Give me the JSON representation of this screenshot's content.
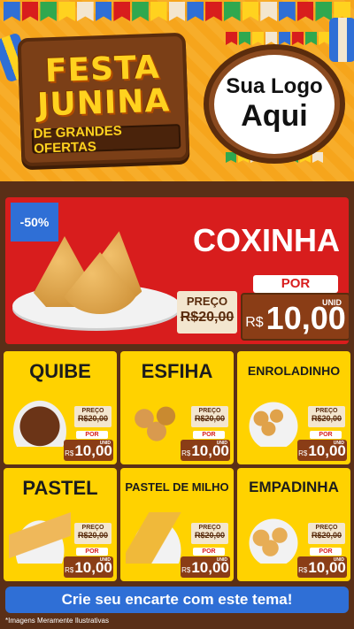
{
  "header": {
    "title_line1": "FESTA",
    "title_line2": "JUNINA",
    "subtitle": "DE GRANDES OFERTAS",
    "logo_line1": "Sua Logo",
    "logo_line2": "Aqui"
  },
  "featured": {
    "badge": "-50%",
    "name": "COXINHA",
    "preco_label": "PREÇO",
    "old_price": "R$20,00",
    "por_label": "POR",
    "currency": "R$",
    "price": "10,00",
    "unit": "UNID"
  },
  "products": [
    {
      "name": "QUIBE",
      "preco_label": "PREÇO",
      "old_price": "R$20,00",
      "por_label": "POR",
      "currency": "R$",
      "price": "10,00",
      "unit": "UNID"
    },
    {
      "name": "ESFIHA",
      "preco_label": "PREÇO",
      "old_price": "R$20,00",
      "por_label": "POR",
      "currency": "R$",
      "price": "10,00",
      "unit": "UNID"
    },
    {
      "name": "ENROLADINHO",
      "preco_label": "PREÇO",
      "old_price": "R$20,00",
      "por_label": "POR",
      "currency": "R$",
      "price": "10,00",
      "unit": "UNID"
    },
    {
      "name": "PASTEL",
      "preco_label": "PREÇO",
      "old_price": "R$20,00",
      "por_label": "POR",
      "currency": "R$",
      "price": "10,00",
      "unit": "UNID"
    },
    {
      "name": "PASTEL DE MILHO",
      "preco_label": "PREÇO",
      "old_price": "R$20,00",
      "por_label": "POR",
      "currency": "R$",
      "price": "10,00",
      "unit": "UNID"
    },
    {
      "name": "EMPADINHA",
      "preco_label": "PREÇO",
      "old_price": "R$20,00",
      "por_label": "POR",
      "currency": "R$",
      "price": "10,00",
      "unit": "UNID"
    }
  ],
  "cta": {
    "label": "Crie seu encarte com este tema!"
  },
  "disclaimer": "*Imagens Meramente Ilustrativas",
  "colors": {
    "header_orange": "#f6a51c",
    "wood_brown": "#5a2f17",
    "featured_red": "#d81d1d",
    "card_yellow": "#ffd200",
    "price_brown": "#8a3d16",
    "title_gold": "#ffd21f",
    "cta_blue": "#2f6fd6"
  },
  "icons": [
    "bunting-flags",
    "paper-lantern",
    "coxinha-food-image",
    "quibe-food-image",
    "esfiha-food-image",
    "enroladinho-food-image",
    "pastel-food-image",
    "pastel-de-milho-food-image",
    "empadinha-food-image"
  ]
}
